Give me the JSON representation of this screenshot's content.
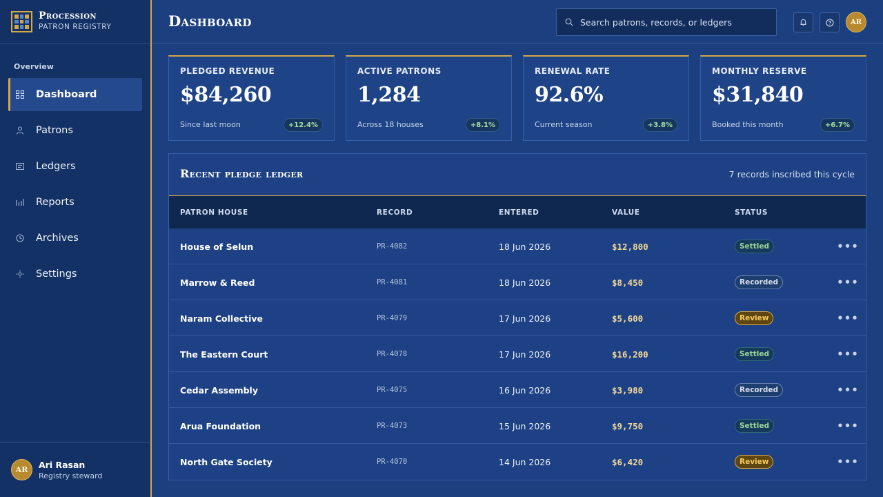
{
  "brand": {
    "name": "Procession",
    "subtitle": "Patron registry"
  },
  "nav": {
    "section": "Overview",
    "items": [
      {
        "label": "Dashboard",
        "icon": "grid-icon",
        "active": true
      },
      {
        "label": "Patrons",
        "icon": "user-icon",
        "active": false
      },
      {
        "label": "Ledgers",
        "icon": "ledger-icon",
        "active": false
      },
      {
        "label": "Reports",
        "icon": "bar-chart-icon",
        "active": false
      },
      {
        "label": "Archives",
        "icon": "clock-icon",
        "active": false
      },
      {
        "label": "Settings",
        "icon": "gear-icon",
        "active": false
      }
    ]
  },
  "user": {
    "initials": "AR",
    "name": "Ari Rasan",
    "role": "Registry steward"
  },
  "header": {
    "title": "Dashboard",
    "search_placeholder": "Search patrons, records, or ledgers",
    "avatar_initials": "AR"
  },
  "stats": [
    {
      "label": "Pledged revenue",
      "value": "$84,260",
      "note": "Since last moon",
      "delta": "+12.4%"
    },
    {
      "label": "Active patrons",
      "value": "1,284",
      "note": "Across 18 houses",
      "delta": "+8.1%"
    },
    {
      "label": "Renewal rate",
      "value": "92.6%",
      "note": "Current season",
      "delta": "+3.8%"
    },
    {
      "label": "Monthly reserve",
      "value": "$31,840",
      "note": "Booked this month",
      "delta": "+6.7%"
    }
  ],
  "ledger": {
    "title": "Recent pledge ledger",
    "count_note": "7 records inscribed this cycle",
    "columns": [
      "Patron house",
      "Record",
      "Entered",
      "Value",
      "Status"
    ],
    "rows": [
      {
        "house": "House of Selun",
        "record": "PR-4082",
        "entered": "18 Jun 2026",
        "value": "$12,800",
        "status": "Settled"
      },
      {
        "house": "Marrow & Reed",
        "record": "PR-4081",
        "entered": "18 Jun 2026",
        "value": "$8,450",
        "status": "Recorded"
      },
      {
        "house": "Naram Collective",
        "record": "PR-4079",
        "entered": "17 Jun 2026",
        "value": "$5,600",
        "status": "Review"
      },
      {
        "house": "The Eastern Court",
        "record": "PR-4078",
        "entered": "17 Jun 2026",
        "value": "$16,200",
        "status": "Settled"
      },
      {
        "house": "Cedar Assembly",
        "record": "PR-4075",
        "entered": "16 Jun 2026",
        "value": "$3,980",
        "status": "Recorded"
      },
      {
        "house": "Arua Foundation",
        "record": "PR-4073",
        "entered": "15 Jun 2026",
        "value": "$9,750",
        "status": "Settled"
      },
      {
        "house": "North Gate Society",
        "record": "PR-4070",
        "entered": "14 Jun 2026",
        "value": "$6,420",
        "status": "Review"
      }
    ],
    "row_action": "•••"
  },
  "colors": {
    "accent_gold": "#d5a946",
    "background": "#1b3f7f",
    "sidebar": "#133164",
    "settled": "#9fd69a",
    "review": "#f7ca5a"
  }
}
